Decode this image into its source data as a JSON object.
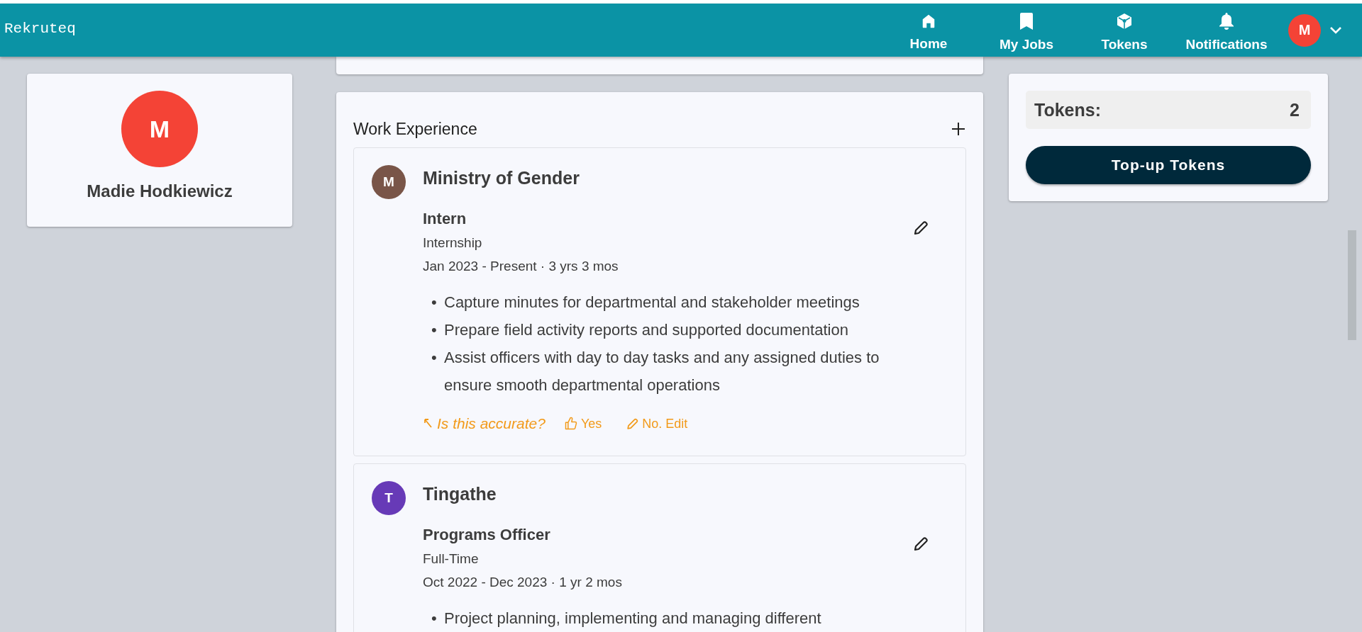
{
  "header": {
    "logo": "Rekruteq",
    "nav": [
      {
        "kind": "home",
        "label": "Home"
      },
      {
        "kind": "bookmark",
        "label": "My Jobs"
      },
      {
        "kind": "cube",
        "label": "Tokens"
      },
      {
        "kind": "bell",
        "label": "Notifications"
      }
    ],
    "avatar": "M"
  },
  "profile": {
    "initial": "M",
    "name": "Madie Hodkiewicz"
  },
  "work_experience": {
    "title": "Work Experience",
    "entries": [
      {
        "initial": "M",
        "color": "#795548",
        "company": "Ministry of Gender",
        "title": "Intern",
        "type": "Internship",
        "dates": "Jan 2023 - Present · 3 yrs 3 mos",
        "bullets": [
          {
            "marker": "•",
            "text": "Capture minutes for departmental and stakeholder meetings"
          },
          {
            "marker": "•",
            "text": "Prepare field activity reports and supported documentation"
          },
          {
            "marker": "•",
            "text": "Assist officers with day to day tasks and any assigned duties to ensure smooth departmental operations"
          }
        ],
        "feedback": {
          "prompt": "Is this accurate?",
          "yes": "Yes",
          "no": "No. Edit"
        }
      },
      {
        "initial": "T",
        "color": "#673ab7",
        "company": "Tingathe",
        "title": "Programs Officer",
        "type": "Full-Time",
        "dates": "Oct 2022 - Dec 2023 · 1 yr 2 mos",
        "bullets": [
          {
            "marker": "•",
            "text": "Project planning, implementing and managing different"
          }
        ]
      }
    ]
  },
  "tokens": {
    "label": "Tokens:",
    "count": "2",
    "button": "Top-up Tokens"
  }
}
